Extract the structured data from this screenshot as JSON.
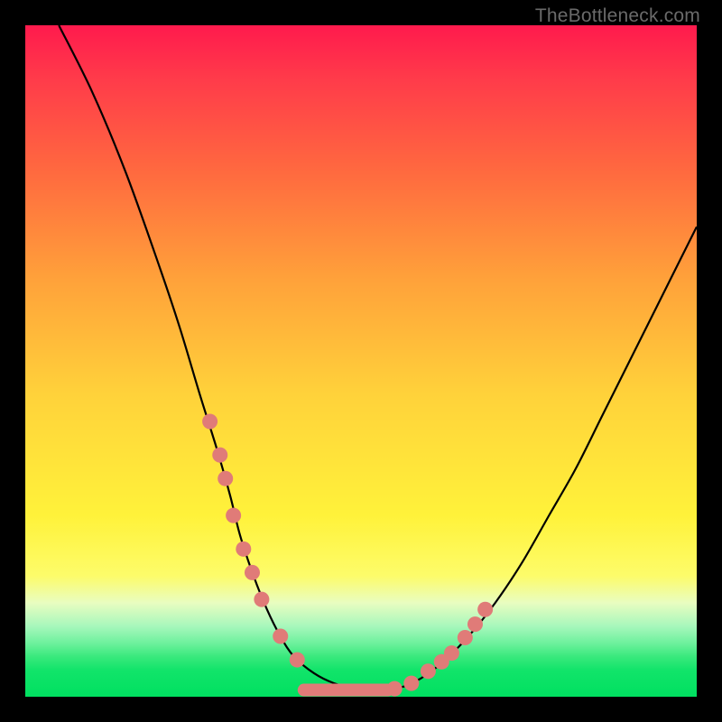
{
  "watermark": "TheBottleneck.com",
  "chart_data": {
    "type": "line",
    "title": "",
    "xlabel": "",
    "ylabel": "",
    "xlim": [
      0,
      100
    ],
    "ylim": [
      0,
      100
    ],
    "grid": false,
    "legend": false,
    "series": [
      {
        "name": "bottleneck-curve",
        "x": [
          5,
          10,
          15,
          20,
          23,
          26,
          28.5,
          30.5,
          32,
          34,
          36,
          38,
          40,
          43,
          46,
          49,
          52,
          55,
          58,
          62,
          66,
          70,
          74,
          78,
          82,
          86,
          90,
          95,
          100
        ],
        "y": [
          100,
          90,
          78,
          64,
          55,
          45,
          37,
          30,
          24,
          18,
          13,
          9,
          6,
          3.5,
          2,
          1.3,
          1,
          1.2,
          2.2,
          5,
          9,
          14,
          20,
          27,
          34,
          42,
          50,
          60,
          70
        ]
      }
    ],
    "scatter_markers": {
      "name": "highlighted-points",
      "color": "#e07b78",
      "points": [
        {
          "x": 27.5,
          "y": 41
        },
        {
          "x": 29.0,
          "y": 36
        },
        {
          "x": 29.8,
          "y": 32.5
        },
        {
          "x": 31.0,
          "y": 27
        },
        {
          "x": 32.5,
          "y": 22
        },
        {
          "x": 33.8,
          "y": 18.5
        },
        {
          "x": 35.2,
          "y": 14.5
        },
        {
          "x": 38.0,
          "y": 9
        },
        {
          "x": 40.5,
          "y": 5.5
        },
        {
          "x": 55.0,
          "y": 1.2
        },
        {
          "x": 57.5,
          "y": 2.0
        },
        {
          "x": 60.0,
          "y": 3.8
        },
        {
          "x": 62.0,
          "y": 5.2
        },
        {
          "x": 63.5,
          "y": 6.5
        },
        {
          "x": 65.5,
          "y": 8.8
        },
        {
          "x": 67.0,
          "y": 10.8
        },
        {
          "x": 68.5,
          "y": 13.0
        }
      ]
    },
    "flat_segment": {
      "name": "optimal-zone",
      "color": "#e07b78",
      "x_start": 41.5,
      "x_end": 54.0,
      "y": 1.0
    }
  }
}
